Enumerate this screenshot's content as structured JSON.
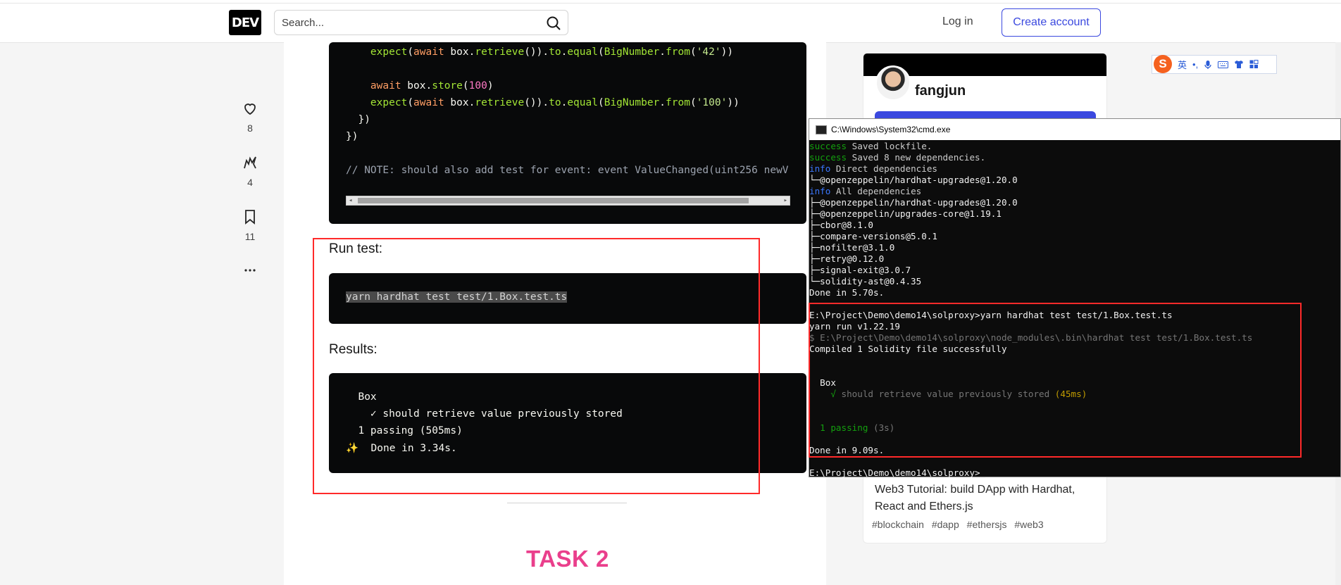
{
  "header": {
    "logo": "DEV",
    "search_placeholder": "Search...",
    "login": "Log in",
    "create_account": "Create account"
  },
  "actions": [
    {
      "name": "heart",
      "count": "8"
    },
    {
      "name": "unicorn",
      "count": "4"
    },
    {
      "name": "bookmark",
      "count": "11"
    }
  ],
  "article": {
    "code1_lines": [
      "    expect(await box.retrieve()).to.equal(BigNumber.from('42'))",
      "",
      "    await box.store(100)",
      "    expect(await box.retrieve()).to.equal(BigNumber.from('100'))",
      "  })",
      "})",
      "",
      "// NOTE: should also add test for event: event ValueChanged(uint256 newV"
    ],
    "run_test_heading": "Run test:",
    "run_command": "yarn hardhat test test/1.Box.test.ts",
    "results_heading": "Results:",
    "results_lines": [
      "  Box",
      "    ✓ should retrieve value previously stored",
      "  1 passing (505ms)",
      "✨  Done in 3.34s."
    ],
    "task2": "TASK 2"
  },
  "sidebar": {
    "username": "fangjun",
    "recommended_title": "Web3 Tutorial: build DApp with Hardhat, React and Ethers.js",
    "tags": [
      "#blockchain",
      "#dapp",
      "#ethersjs",
      "#web3"
    ]
  },
  "ime": {
    "logo": "S",
    "lang": "英",
    "punct": "•,"
  },
  "cmd": {
    "title": "C:\\Windows\\System32\\cmd.exe",
    "lines": [
      {
        "prefix": "success",
        "prefix_color": "green",
        "text": " Saved lockfile."
      },
      {
        "prefix": "success",
        "prefix_color": "green",
        "text": " Saved 8 new dependencies."
      },
      {
        "prefix": "info",
        "prefix_color": "blue",
        "text": " Direct dependencies"
      },
      {
        "prefix": "",
        "prefix_color": "",
        "text": "└─@openzeppelin/hardhat-upgrades@1.20.0"
      },
      {
        "prefix": "info",
        "prefix_color": "blue",
        "text": " All dependencies"
      },
      {
        "prefix": "",
        "prefix_color": "",
        "text": "├─@openzeppelin/hardhat-upgrades@1.20.0"
      },
      {
        "prefix": "",
        "prefix_color": "",
        "text": "├─@openzeppelin/upgrades-core@1.19.1"
      },
      {
        "prefix": "",
        "prefix_color": "",
        "text": "├─cbor@8.1.0"
      },
      {
        "prefix": "",
        "prefix_color": "",
        "text": "├─compare-versions@5.0.1"
      },
      {
        "prefix": "",
        "prefix_color": "",
        "text": "├─nofilter@3.1.0"
      },
      {
        "prefix": "",
        "prefix_color": "",
        "text": "├─retry@0.12.0"
      },
      {
        "prefix": "",
        "prefix_color": "",
        "text": "├─signal-exit@3.0.7"
      },
      {
        "prefix": "",
        "prefix_color": "",
        "text": "└─solidity-ast@0.4.35"
      },
      {
        "prefix": "",
        "prefix_color": "",
        "text": "Done in 5.70s."
      },
      {
        "prefix": "",
        "prefix_color": "",
        "text": ""
      },
      {
        "prefix": "",
        "prefix_color": "",
        "text": "E:\\Project\\Demo\\demo14\\solproxy>yarn hardhat test test/1.Box.test.ts"
      },
      {
        "prefix": "",
        "prefix_color": "",
        "text": "yarn run v1.22.19"
      },
      {
        "prefix": "",
        "prefix_color": "gray",
        "text": "$ E:\\Project\\Demo\\demo14\\solproxy\\node_modules\\.bin\\hardhat test test/1.Box.test.ts"
      },
      {
        "prefix": "",
        "prefix_color": "",
        "text": "Compiled 1 Solidity file successfully"
      },
      {
        "prefix": "",
        "prefix_color": "",
        "text": ""
      },
      {
        "prefix": "",
        "prefix_color": "",
        "text": ""
      },
      {
        "prefix": "",
        "prefix_color": "",
        "text": "  Box"
      },
      {
        "prefix": "",
        "prefix_color": "",
        "text": "    √ should retrieve value previously stored (45ms)"
      },
      {
        "prefix": "",
        "prefix_color": "",
        "text": ""
      },
      {
        "prefix": "",
        "prefix_color": "",
        "text": ""
      },
      {
        "prefix": "",
        "prefix_color": "",
        "text": "  1 passing (3s)"
      },
      {
        "prefix": "",
        "prefix_color": "",
        "text": ""
      },
      {
        "prefix": "",
        "prefix_color": "",
        "text": "Done in 9.09s."
      },
      {
        "prefix": "",
        "prefix_color": "",
        "text": ""
      },
      {
        "prefix": "",
        "prefix_color": "",
        "text": "E:\\Project\\Demo\\demo14\\solproxy>_"
      }
    ]
  },
  "colors": {
    "accent": "#3b49df",
    "highlight_box": "#ff2a2a",
    "task_pink": "#ea3f8c"
  }
}
